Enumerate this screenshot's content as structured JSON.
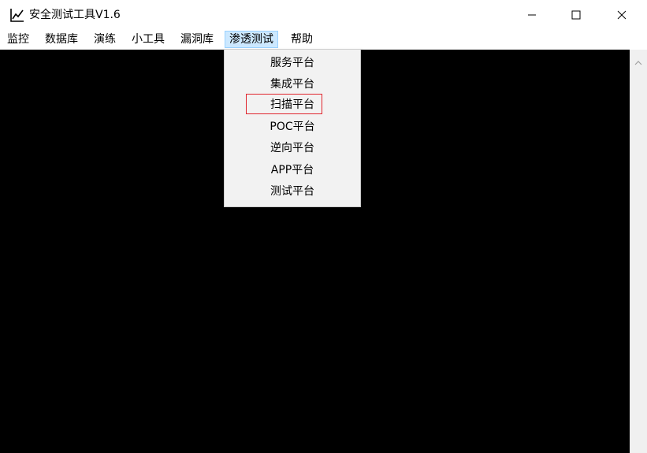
{
  "window": {
    "title": "安全测试工具V1.6",
    "icon": "chart-line-icon",
    "controls": [
      "minimize-icon",
      "maximize-icon",
      "close-icon"
    ]
  },
  "menubar": {
    "items": [
      {
        "label": "监控",
        "active": false
      },
      {
        "label": "数据库",
        "active": false
      },
      {
        "label": "演练",
        "active": false
      },
      {
        "label": "小工具",
        "active": false
      },
      {
        "label": "漏洞库",
        "active": false
      },
      {
        "label": "渗透测试",
        "active": true
      },
      {
        "label": "帮助",
        "active": false
      }
    ]
  },
  "dropdown": {
    "parent": "渗透测试",
    "items": [
      {
        "label": "服务平台"
      },
      {
        "label": "集成平台"
      },
      {
        "label": "扫描平台",
        "highlighted": true
      },
      {
        "label": "POC平台"
      },
      {
        "label": "逆向平台"
      },
      {
        "label": "APP平台"
      },
      {
        "label": "测试平台"
      }
    ]
  },
  "colors": {
    "content_background": "#000000",
    "menu_active_bg": "#cce8ff",
    "menu_active_border": "#99d1ff",
    "dropdown_bg": "#f2f2f2",
    "highlight_border": "#e0242c"
  }
}
